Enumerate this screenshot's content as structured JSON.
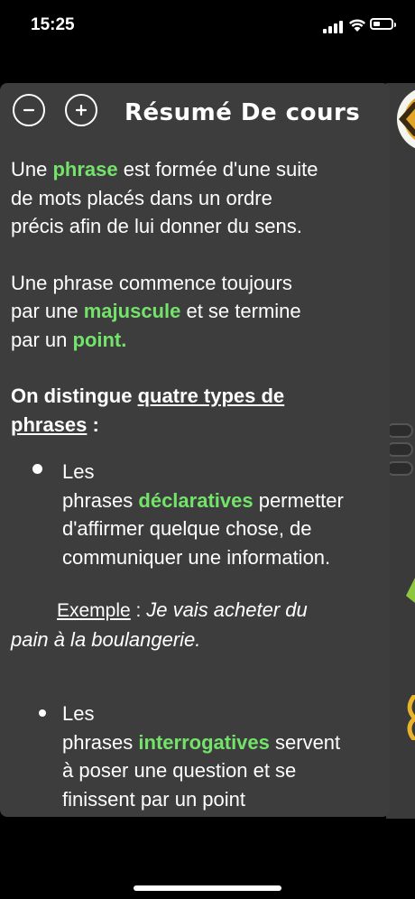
{
  "status_bar": {
    "time": "15:25"
  },
  "header": {
    "title": "Résumé De cours"
  },
  "content": {
    "p1_l1_a": "Une ",
    "p1_l1_b": "phrase",
    "p1_l1_c": " est formée d'une suite",
    "p1_l2": "de mots placés dans un ordre",
    "p1_l3": "précis afin de lui donner du sens.",
    "p2_l1": "Une phrase commence toujours",
    "p2_l2_a": "par une ",
    "p2_l2_b": "majuscule",
    "p2_l2_c": " et se termine",
    "p3_l1_a": "par un ",
    "p3_l1_b": "point.",
    "h_l1_a": "On distingue ",
    "h_l1_b": "quatre types de",
    "h_l2_a": "phrases",
    "h_l2_b": " :",
    "b1_l1": "Les",
    "b1_l2_a": "phrases ",
    "b1_l2_b": "déclaratives",
    "b1_l2_c": " permetter",
    "b1_l3": "d'affirmer quelque chose, de",
    "b1_l4": "communiquer une information.",
    "ex_label": "Exemple",
    "ex_sep": " : ",
    "ex_l1": "Je vais acheter du",
    "ex_l2": "pain à la boulangerie.",
    "b2_l1": "Les",
    "b2_l2_a": "phrases ",
    "b2_l2_b": "interrogatives",
    "b2_l2_c": " servent",
    "b2_l3": "à poser une question et se",
    "b2_l4": "finissent par un point"
  },
  "colors": {
    "highlight": "#73e36a",
    "panel": "#3d3d3d",
    "background": "#000000"
  }
}
